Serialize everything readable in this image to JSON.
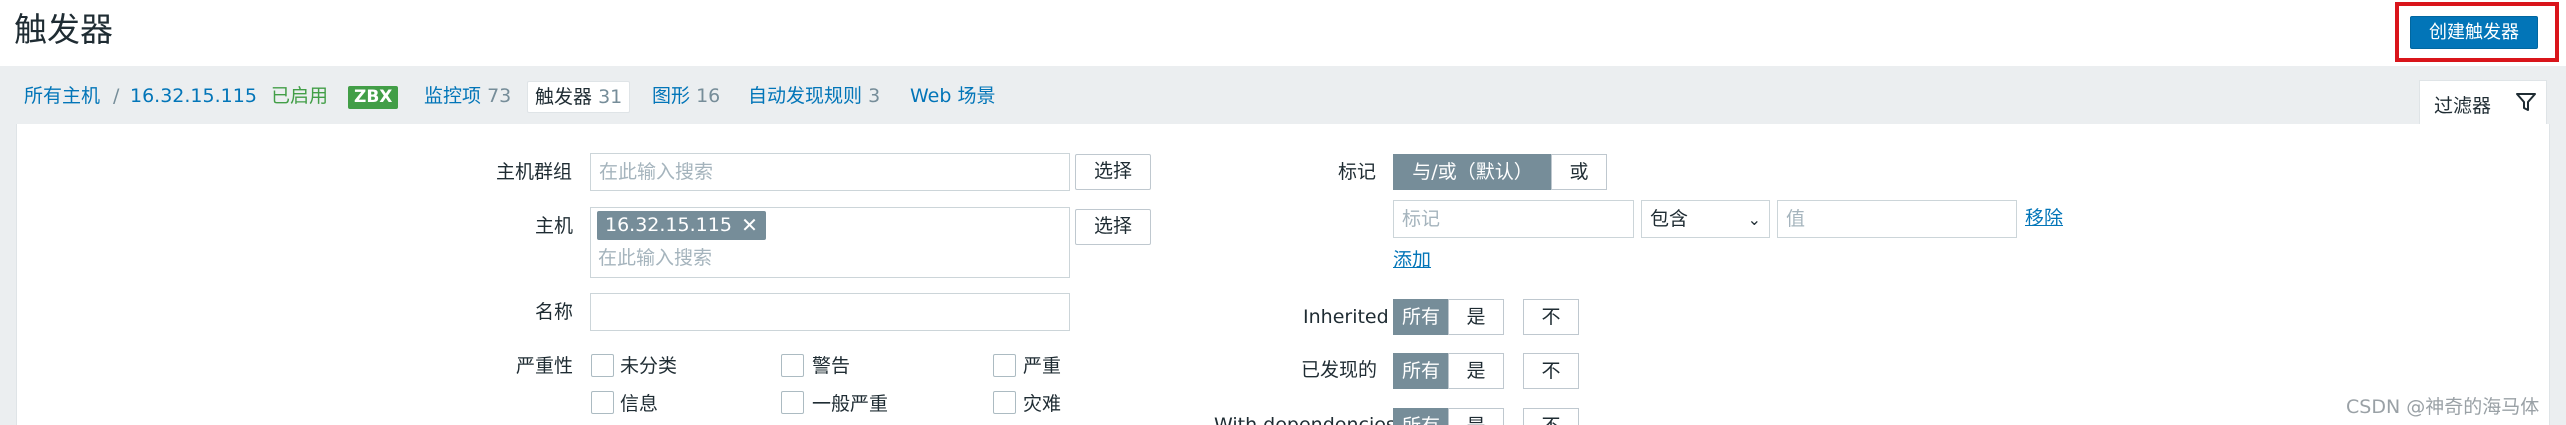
{
  "header": {
    "title": "触发器",
    "create_button": "创建触发器"
  },
  "breadcrumb": {
    "all_hosts": "所有主机",
    "separator": "/",
    "host": "16.32.15.115",
    "enabled": "已启用",
    "zbx": "ZBX",
    "items": {
      "label": "监控项",
      "count": "73"
    },
    "triggers": {
      "label": "触发器",
      "count": "31"
    },
    "graphs": {
      "label": "图形",
      "count": "16"
    },
    "discovery": {
      "label": "自动发现规则",
      "count": "3"
    },
    "web": "Web 场景"
  },
  "filter_tab": {
    "label": "过滤器",
    "icon": "funnel-icon"
  },
  "filter": {
    "host_groups": {
      "label": "主机群组",
      "placeholder": "在此输入搜索",
      "select": "选择"
    },
    "hosts": {
      "label": "主机",
      "chip": "16.32.15.115",
      "placeholder": "在此输入搜索",
      "select": "选择"
    },
    "name": {
      "label": "名称",
      "value": ""
    },
    "severity": {
      "label": "严重性",
      "options": [
        "未分类",
        "警告",
        "严重",
        "信息",
        "一般严重",
        "灾难"
      ]
    },
    "tags": {
      "label": "标记",
      "and_or": "与/或（默认）",
      "or": "或",
      "tag_placeholder": "标记",
      "operator": "包含",
      "value_placeholder": "值",
      "remove": "移除",
      "add": "添加"
    },
    "inherited": {
      "label": "Inherited",
      "options": [
        "所有",
        "是",
        "不"
      ],
      "selected": "所有"
    },
    "discovered": {
      "label": "已发现的",
      "options": [
        "所有",
        "是",
        "不"
      ],
      "selected": "所有"
    },
    "dependencies": {
      "label": "With dependencies",
      "options": [
        "所有",
        "是",
        "不"
      ],
      "selected": "所有"
    }
  },
  "watermark": "CSDN @神奇的海马体",
  "colors": {
    "accent": "#0275b8",
    "enabled": "#429e47",
    "highlight_border": "#d9151b",
    "segment_on": "#768d99"
  }
}
